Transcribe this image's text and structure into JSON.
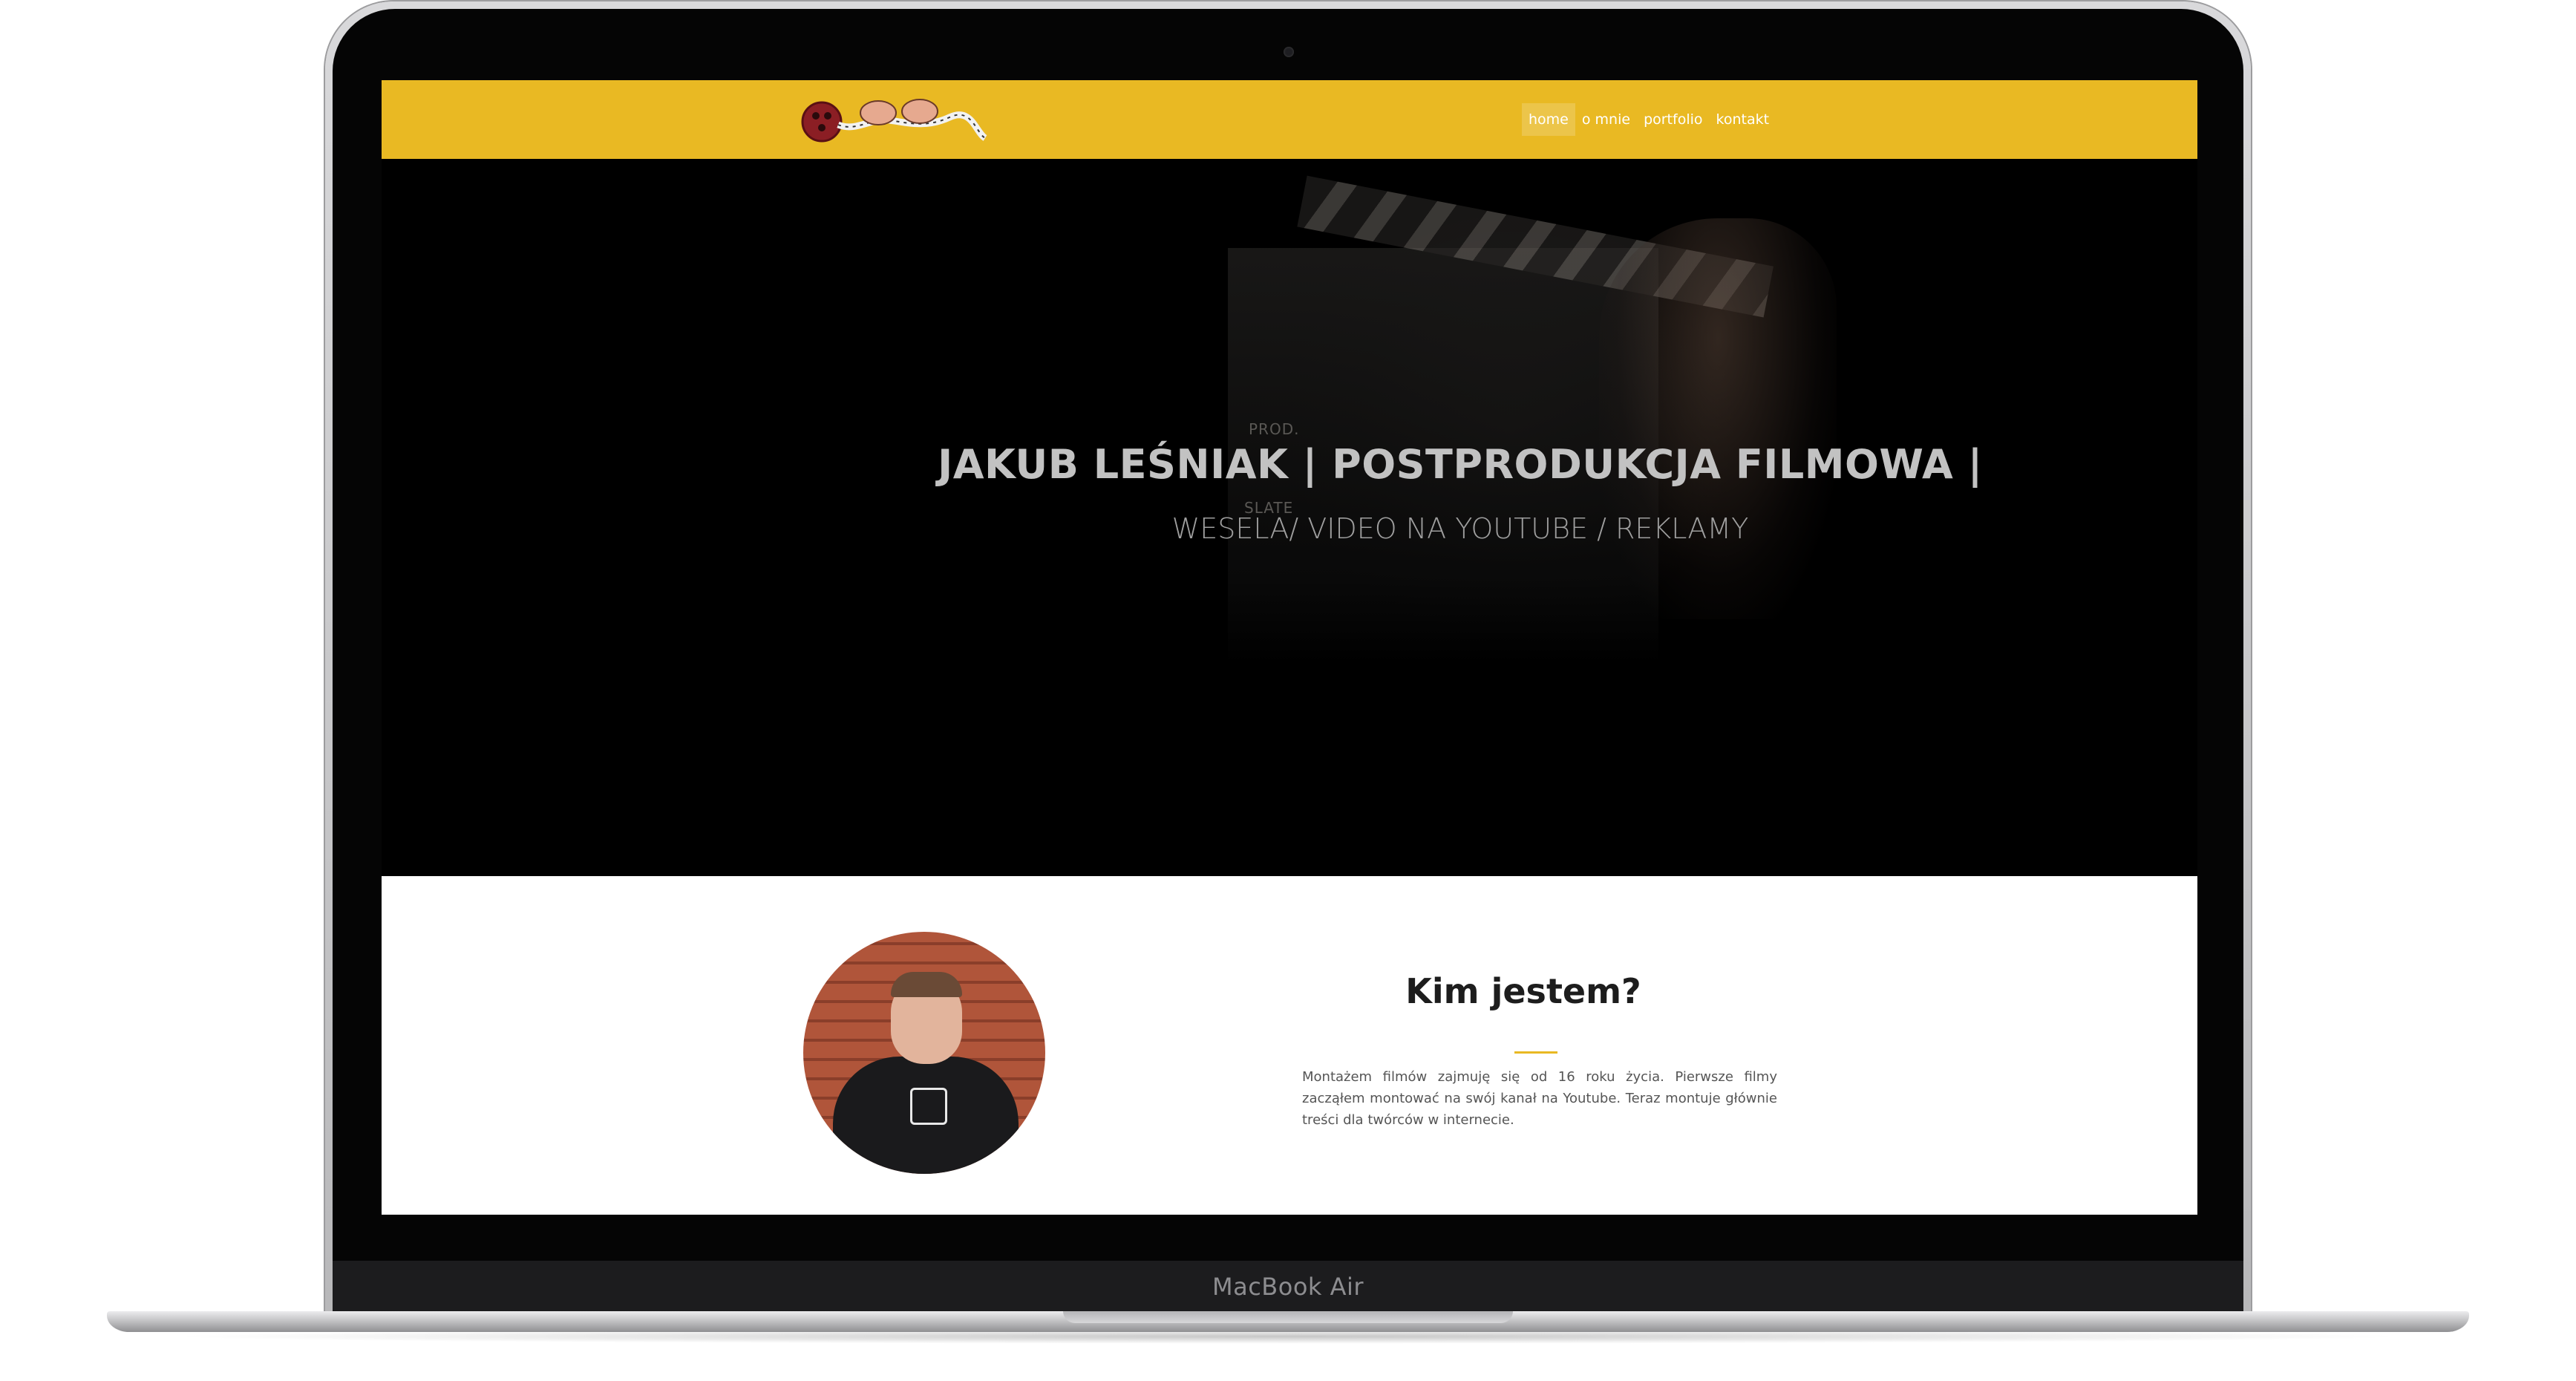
{
  "device": {
    "label": "MacBook Air"
  },
  "nav": {
    "items": [
      {
        "label": "home",
        "active": true
      },
      {
        "label": "o mnie",
        "active": false
      },
      {
        "label": "portfolio",
        "active": false
      },
      {
        "label": "kontakt",
        "active": false
      }
    ]
  },
  "hero": {
    "title": "JAKUB LEŚNIAK | POSTPRODUKCJA FILMOWA |",
    "subtitle": "WESELA/ VIDEO NA YOUTUBE / REKLAMY",
    "slate": {
      "prod": "PROD.",
      "slate": "SLATE"
    }
  },
  "about": {
    "title": "Kim jestem?",
    "text": "Montażem filmów zajmuję się od 16 roku życia. Pierwsze filmy zacząłem montować na swój kanał na Youtube. Teraz montuje głównie treści dla twórców w internecie."
  },
  "colors": {
    "accent": "#e9b923",
    "hero_bg": "#000000",
    "about_bg": "#ffffff"
  }
}
